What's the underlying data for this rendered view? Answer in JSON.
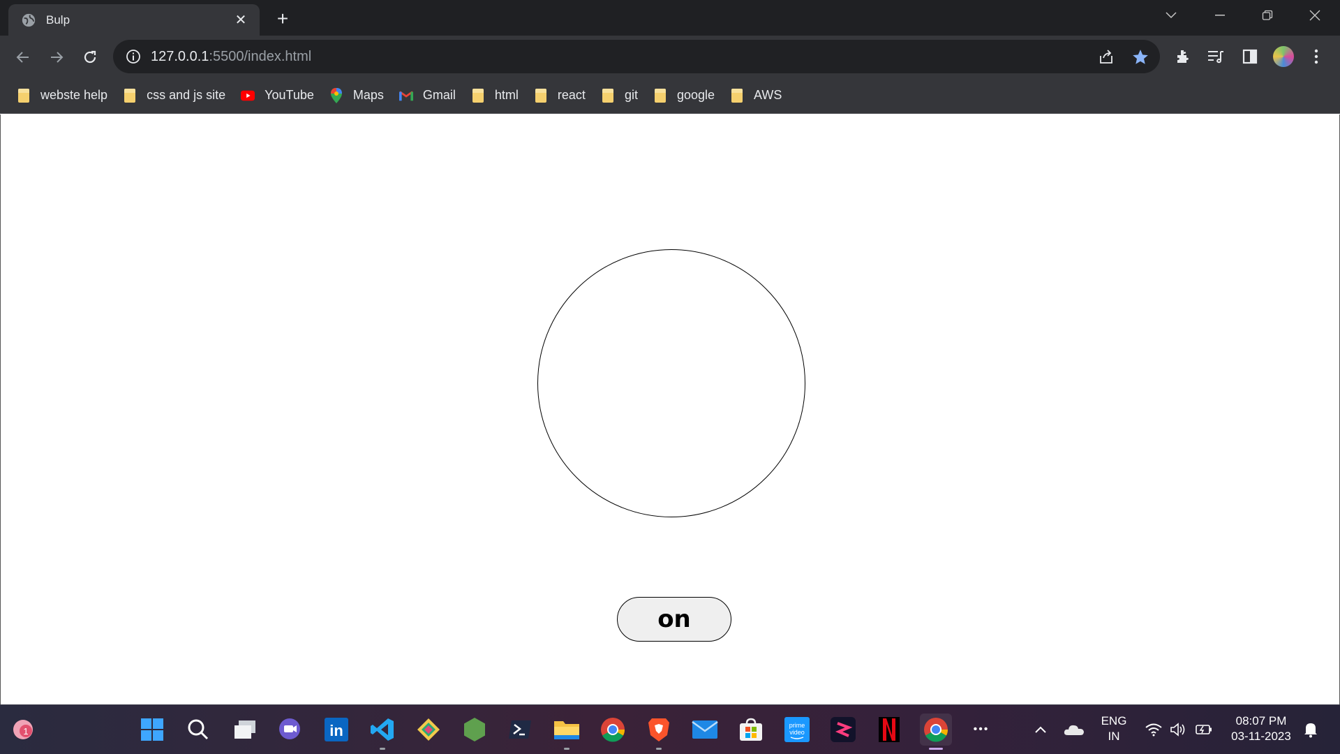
{
  "browser": {
    "tab_title": "Bulp",
    "tab_close": "✕",
    "new_tab": "+",
    "url_host": "127.0.0.1",
    "url_rest": ":5500/index.html"
  },
  "bookmarks": [
    {
      "label": "webste help",
      "icon": "folder-icon"
    },
    {
      "label": "css and js site",
      "icon": "folder-icon"
    },
    {
      "label": "YouTube",
      "icon": "youtube-icon"
    },
    {
      "label": "Maps",
      "icon": "maps-icon"
    },
    {
      "label": "Gmail",
      "icon": "gmail-icon"
    },
    {
      "label": "html",
      "icon": "folder-icon"
    },
    {
      "label": "react",
      "icon": "folder-icon"
    },
    {
      "label": "git",
      "icon": "folder-icon"
    },
    {
      "label": "google",
      "icon": "folder-icon"
    },
    {
      "label": "AWS",
      "icon": "folder-icon"
    }
  ],
  "page": {
    "button_label": "on"
  },
  "taskbar": {
    "lang_line1": "ENG",
    "lang_line2": "IN",
    "time": "08:07 PM",
    "date": "03-11-2023",
    "more": "•••",
    "notification_count": "1"
  },
  "colors": {
    "chrome_dark": "#1f2023",
    "chrome_toolbar": "#35363a",
    "star_blue": "#8ab4f8"
  }
}
